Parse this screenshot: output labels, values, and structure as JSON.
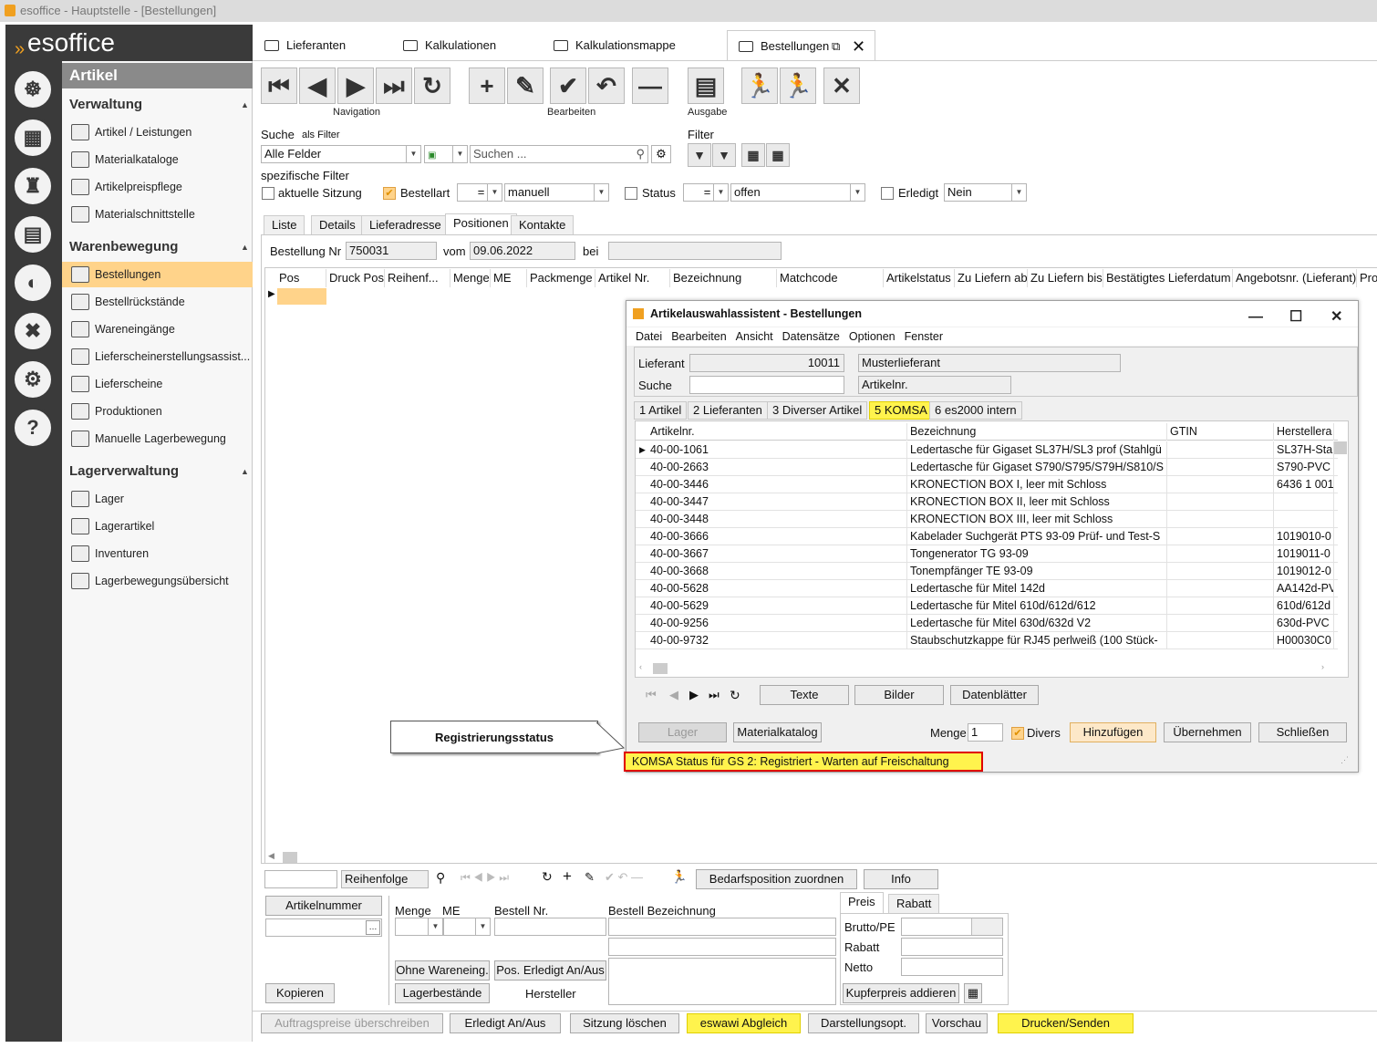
{
  "window": {
    "title": "esoffice - Hauptstelle - [Bestellungen]"
  },
  "brand": {
    "name": "esoffice"
  },
  "sidebar": {
    "header": "Artikel",
    "groups": [
      {
        "title": "Verwaltung",
        "items": [
          "Artikel / Leistungen",
          "Materialkataloge",
          "Artikelpreispflege",
          "Materialschnittstelle"
        ]
      },
      {
        "title": "Warenbewegung",
        "items": [
          "Bestellungen",
          "Bestellrückstände",
          "Wareneingänge",
          "Lieferscheinerstellungsassist...",
          "Lieferscheine",
          "Produktionen",
          "Manuelle Lagerbewegung"
        ]
      },
      {
        "title": "Lagerverwaltung",
        "items": [
          "Lager",
          "Lagerartikel",
          "Inventuren",
          "Lagerbewegungsübersicht"
        ]
      }
    ]
  },
  "tabs": [
    "Lieferanten",
    "Kalkulationen",
    "Kalkulationsmappe",
    "Bestellungen"
  ],
  "toolbar": {
    "navigation": "Navigation",
    "bearbeiten": "Bearbeiten",
    "ausgabe": "Ausgabe"
  },
  "search": {
    "label": "Suche",
    "as_filter": "als Filter",
    "field": "Alle Felder",
    "placeholder": "Suchen ...",
    "filter_label": "Filter",
    "specific": "spezifische Filter"
  },
  "filters": {
    "aktuelle_sitzung": "aktuelle Sitzung",
    "bestellart": "Bestellart",
    "op": "=",
    "bestellart_value": "manuell",
    "status": "Status",
    "status_value": "offen",
    "erledigt": "Erledigt",
    "erledigt_value": "Nein"
  },
  "subtabs": [
    "Liste",
    "Details",
    "Lieferadresse",
    "Positionen",
    "Kontakte"
  ],
  "order": {
    "nr_label": "Bestellung Nr",
    "nr": "750031",
    "vom_label": "vom",
    "date": "09.06.2022",
    "bei_label": "bei"
  },
  "grid_columns": [
    "Pos",
    "Druck Pos",
    "Reihenf...",
    "Menge",
    "ME",
    "Packmenge",
    "Artikel Nr.",
    "Bezeichnung",
    "Matchcode",
    "Artikelstatus",
    "Zu Liefern ab",
    "Zu Liefern bis",
    "Bestätigtes Lieferdatum",
    "Angebotsnr. (Lieferant)",
    "Pro"
  ],
  "dialog": {
    "title": "Artikelauswahlassistent - Bestellungen",
    "menu": [
      "Datei",
      "Bearbeiten",
      "Ansicht",
      "Datensätze",
      "Optionen",
      "Fenster"
    ],
    "lieferant_label": "Lieferant",
    "lieferant_nr": "10011",
    "lieferant_name": "Musterlieferant",
    "suche_label": "Suche",
    "suche_field": "Artikelnr.",
    "tabs": [
      "1 Artikel",
      "2 Lieferanten",
      "3 Diverser Artikel",
      "5 KOMSA",
      "6 es2000 intern"
    ],
    "columns": [
      "Artikelnr.",
      "Bezeichnung",
      "GTIN",
      "Herstellera"
    ],
    "rows": [
      [
        "40-00-1061",
        "Ledertasche für Gigaset SL37H/SL3 prof (Stahlgü",
        "",
        "SL37H-Sta"
      ],
      [
        "40-00-2663",
        "Ledertasche für Gigaset S790/S795/S79H/S810/S",
        "",
        "S790-PVC"
      ],
      [
        "40-00-3446",
        "KRONECTION BOX I, leer mit Schloss",
        "",
        "6436 1 001"
      ],
      [
        "40-00-3447",
        "KRONECTION BOX II, leer mit Schloss",
        "",
        ""
      ],
      [
        "40-00-3448",
        "KRONECTION BOX III, leer mit Schloss",
        "",
        ""
      ],
      [
        "40-00-3666",
        "Kabelader Suchgerät PTS 93-09 Prüf- und Test-S",
        "",
        "1019010-0"
      ],
      [
        "40-00-3667",
        "Tongenerator TG 93-09",
        "",
        "1019011-0"
      ],
      [
        "40-00-3668",
        "Tonempfänger TE 93-09",
        "",
        "1019012-0"
      ],
      [
        "40-00-5628",
        "Ledertasche für Mitel 142d",
        "",
        "AA142d-PV"
      ],
      [
        "40-00-5629",
        "Ledertasche für Mitel 610d/612d/612",
        "",
        "610d/612d"
      ],
      [
        "40-00-9256",
        "Ledertasche für Mitel 630d/632d V2",
        "",
        "630d-PVC"
      ],
      [
        "40-00-9732",
        "Staubschutzkappe für RJ45 perlweiß (100 Stück-",
        "",
        "H00030C0"
      ]
    ],
    "buttons": {
      "texte": "Texte",
      "bilder": "Bilder",
      "datenblaetter": "Datenblätter",
      "lager": "Lager",
      "materialkatalog": "Materialkatalog",
      "menge_label": "Menge",
      "menge": "1",
      "divers": "Divers",
      "hinzufuegen": "Hinzufügen",
      "uebernehmen": "Übernehmen",
      "schliessen": "Schließen"
    },
    "status": "KOMSA Status für GS 2: Registriert - Warten auf Freischaltung"
  },
  "callout": "Registrierungsstatus",
  "lower": {
    "reihenfolge": "Reihenfolge",
    "bedarf": "Bedarfsposition zuordnen",
    "info": "Info",
    "artikelnummer": "Artikelnummer",
    "menge": "Menge",
    "me": "ME",
    "bestell_nr": "Bestell Nr.",
    "bestell_bez": "Bestell Bezeichnung",
    "preis": "Preis",
    "rabatt_tab": "Rabatt",
    "brutto": "Brutto/PE",
    "rabatt": "Rabatt",
    "netto": "Netto",
    "ohne": "Ohne Wareneing.",
    "pos_erledigt": "Pos. Erledigt An/Aus",
    "lagerbestaende": "Lagerbestände",
    "hersteller": "Hersteller",
    "kupfer": "Kupferpreis addieren",
    "kopieren": "Kopieren"
  },
  "footer": [
    "Auftragspreise überschreiben",
    "Erledigt An/Aus",
    "Sitzung löschen",
    "eswawi Abgleich",
    "Darstellungsopt.",
    "Vorschau",
    "Drucken/Senden"
  ],
  "colors": {
    "accent": "#f0a020",
    "highlight": "#fff34d",
    "selected": "#ffd38a",
    "status_border": "#e00000"
  }
}
